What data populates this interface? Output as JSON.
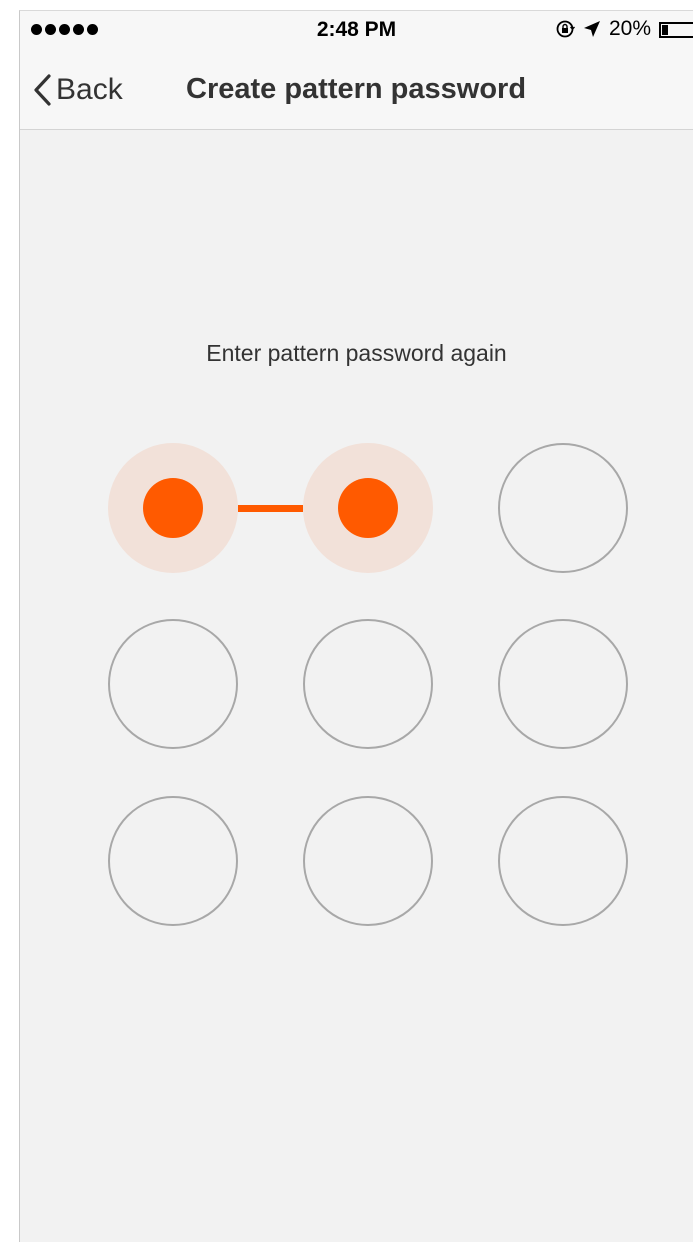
{
  "status_bar": {
    "time": "2:48 PM",
    "battery": "20%",
    "battery_level": 0.2,
    "icons": [
      "signal-dots-icon",
      "rotation-lock-icon",
      "location-arrow-icon",
      "battery-icon"
    ]
  },
  "nav": {
    "back_label": "Back",
    "title": "Create pattern password"
  },
  "prompt": "Enter pattern password again",
  "pattern": {
    "selected": [
      0,
      1
    ],
    "accent_color": "#ff5a00",
    "halo_color": "#f2e1d9",
    "ring_color": "#a8a8a8"
  }
}
